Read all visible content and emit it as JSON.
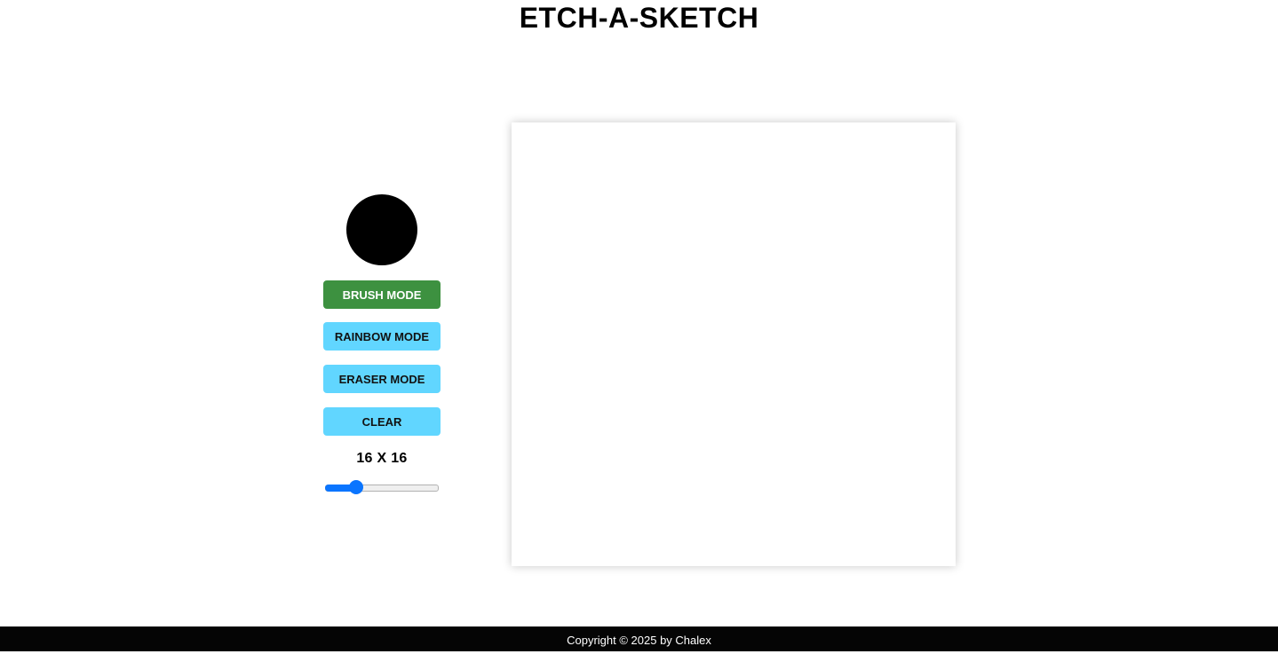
{
  "header": {
    "title": "ETCH-A-SKETCH"
  },
  "controls": {
    "color_picker": {
      "value": "#000000",
      "icon": "color-swatch-circle"
    },
    "buttons": {
      "brush": "BRUSH MODE",
      "rainbow": "RAINBOW MODE",
      "eraser": "ERASER MODE",
      "clear": "CLEAR"
    },
    "active_mode": "brush",
    "grid_size_label": "16 X 16",
    "grid_slider": {
      "value": 16,
      "min": 1,
      "max": 64
    }
  },
  "colors": {
    "active_button": "#3d9140",
    "inactive_button": "#61d6ff",
    "slider_accent": "#0a75ff",
    "footer_background": "#050505"
  },
  "footer": {
    "text": "Copyright © 2025 by Chalex"
  }
}
